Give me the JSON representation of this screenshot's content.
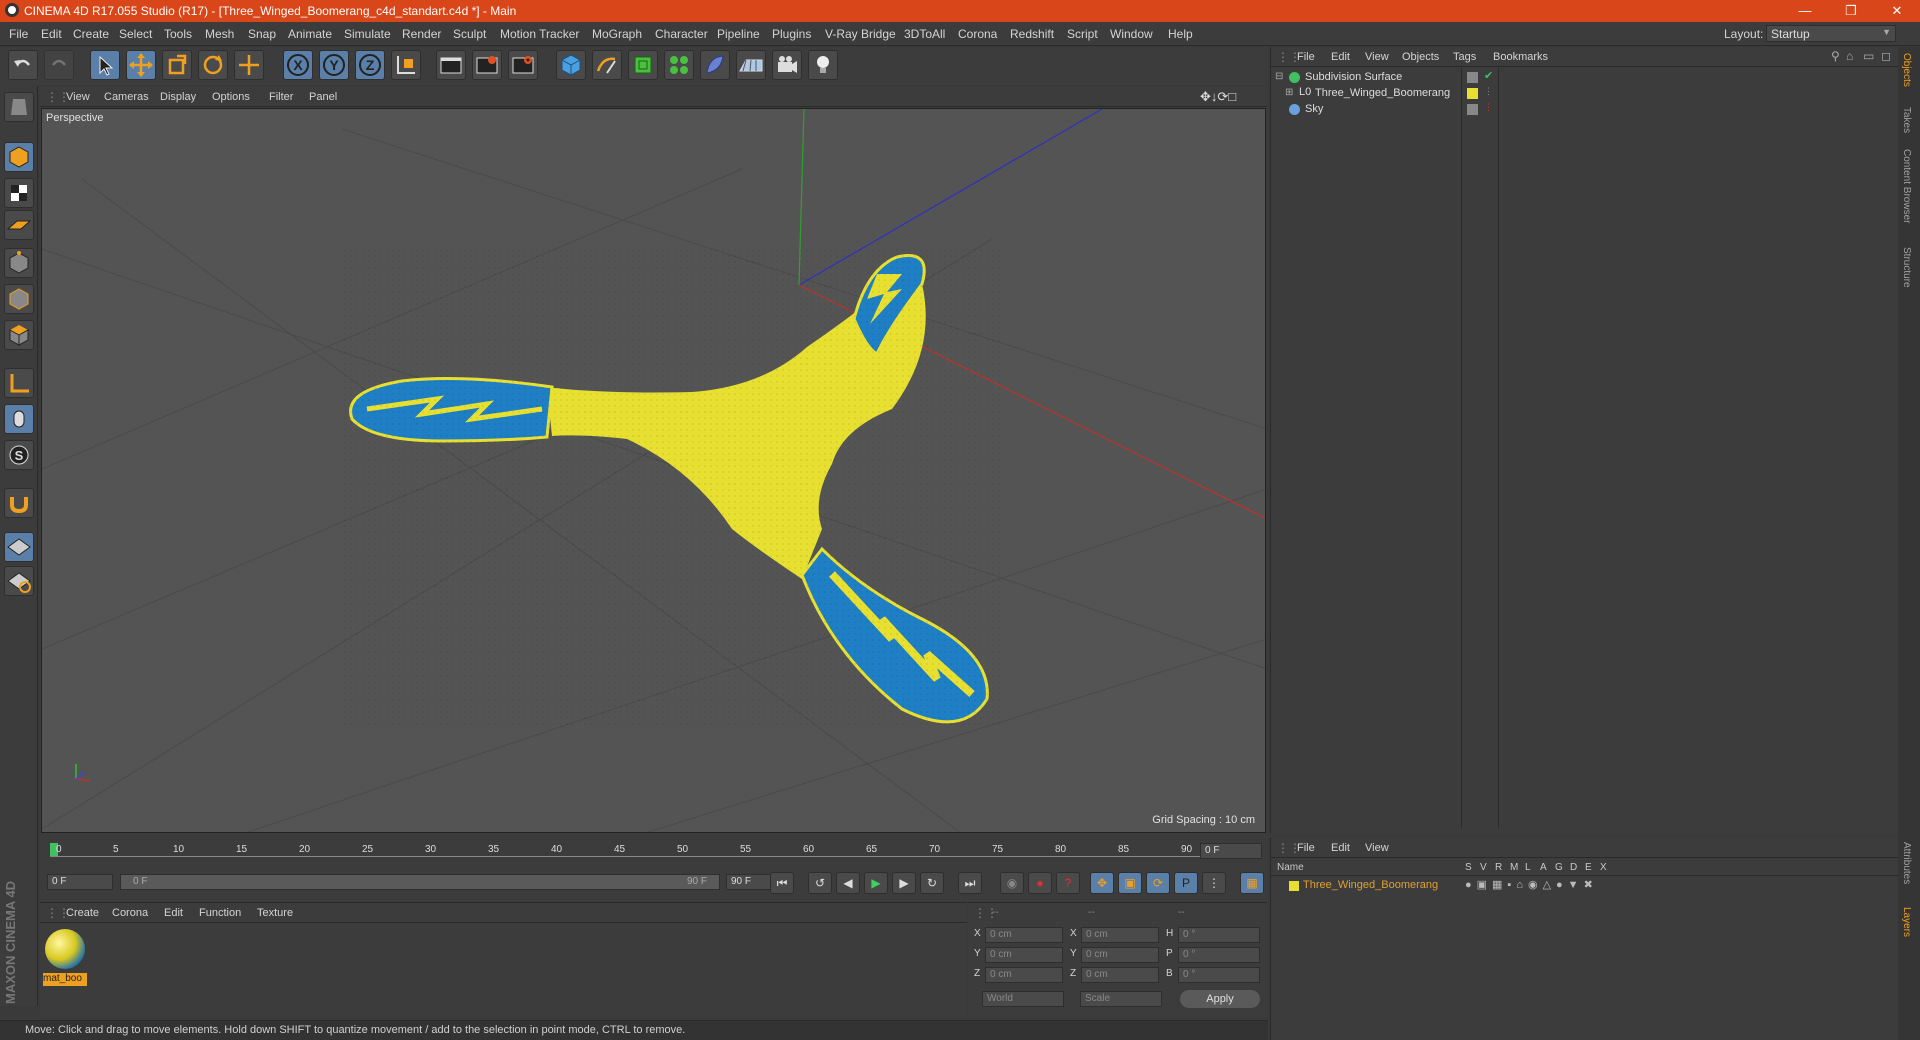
{
  "window": {
    "title": "CINEMA 4D R17.055 Studio (R17) - [Three_Winged_Boomerang_c4d_standart.c4d *] - Main"
  },
  "menu": [
    "File",
    "Edit",
    "Create",
    "Select",
    "Tools",
    "Mesh",
    "Snap",
    "Animate",
    "Simulate",
    "Render",
    "Sculpt",
    "Motion Tracker",
    "MoGraph",
    "Character",
    "Pipeline",
    "Plugins",
    "V-Ray Bridge",
    "3DToAll",
    "Corona",
    "Redshift",
    "Script",
    "Window",
    "Help"
  ],
  "layout": {
    "label": "Layout:",
    "value": "Startup"
  },
  "viewport_menu": [
    "View",
    "Cameras",
    "Display",
    "Options",
    "Filter",
    "Panel"
  ],
  "viewport": {
    "name": "Perspective",
    "grid_spacing": "Grid Spacing : 10 cm"
  },
  "timeline": {
    "ticks": [
      "0",
      "5",
      "10",
      "15",
      "20",
      "25",
      "30",
      "35",
      "40",
      "45",
      "50",
      "55",
      "60",
      "65",
      "70",
      "75",
      "80",
      "85",
      "90"
    ],
    "frame_field": "0 F"
  },
  "anim": {
    "start": "0 F",
    "range_start": "0 F",
    "range_end": "90 F",
    "end": "90 F"
  },
  "material_menu": [
    "Create",
    "Corona",
    "Edit",
    "Function",
    "Texture"
  ],
  "material": {
    "name": "mat_boo"
  },
  "coords": {
    "headers": [
      "--",
      "--",
      "--"
    ],
    "rows": [
      {
        "a": "X",
        "av": "0 cm",
        "b": "X",
        "bv": "0 cm",
        "c": "H",
        "cv": "0 °"
      },
      {
        "a": "Y",
        "av": "0 cm",
        "b": "Y",
        "bv": "0 cm",
        "c": "P",
        "cv": "0 °"
      },
      {
        "a": "Z",
        "av": "0 cm",
        "b": "Z",
        "bv": "0 cm",
        "c": "B",
        "cv": "0 °"
      }
    ],
    "world": "World",
    "scale": "Scale",
    "apply": "Apply"
  },
  "status": "Move: Click and drag to move elements. Hold down SHIFT to quantize movement / add to the selection in point mode, CTRL to remove.",
  "objects_menu": [
    "File",
    "Edit",
    "View",
    "Objects",
    "Tags",
    "Bookmarks"
  ],
  "objects": [
    {
      "name": "Subdivision Surface"
    },
    {
      "name": "Three_Winged_Boomerang"
    },
    {
      "name": "Sky"
    }
  ],
  "layers_menu": [
    "File",
    "Edit",
    "View"
  ],
  "layers_header": {
    "name": "Name",
    "cols": [
      "S",
      "V",
      "R",
      "M",
      "L",
      "A",
      "G",
      "D",
      "E",
      "X"
    ]
  },
  "layers": [
    {
      "name": "Three_Winged_Boomerang"
    }
  ],
  "side_tabs_top": [
    "Objects",
    "Takes",
    "Content Browser",
    "Structure"
  ],
  "side_tabs_bottom": [
    "Attributes",
    "Layers"
  ],
  "brand": "MAXON CINEMA 4D",
  "colors": {
    "title": "#d9461a",
    "accent": "#5a7fa8",
    "boomerang_yellow": "#e8e030",
    "boomerang_blue": "#1f7fc4",
    "layer_name": "#e0a030"
  }
}
